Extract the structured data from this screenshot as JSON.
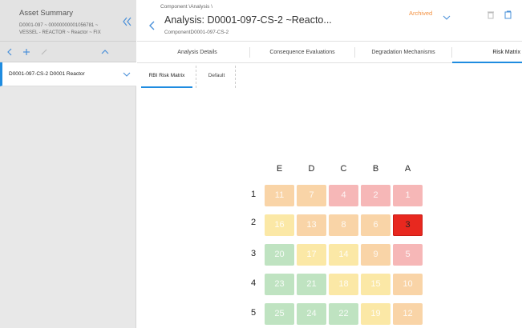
{
  "asset_summary": {
    "title": "Asset Summary",
    "line1": "D0001-097 ~ 00000000001056781 ~",
    "line2": "VESSEL - REACTOR ~ Reactor ~ FIX"
  },
  "left_item": {
    "label": "D0001-097-CS-2 D0001 Reactor"
  },
  "header": {
    "breadcrumb": "Component \\Analysis \\",
    "title": "Analysis: D0001-097-CS-2 ~Reacto...",
    "subtitle": "ComponentD0001-097-CS-2",
    "status": "Archived"
  },
  "tabs": [
    "Analysis Details",
    "Consequence Evaluations",
    "Degradation Mechanisms",
    "Risk Matrix"
  ],
  "subtabs": [
    "RBI Risk Matrix",
    "Default"
  ],
  "matrix": {
    "columns": [
      "E",
      "D",
      "C",
      "B",
      "A"
    ],
    "rows": [
      "1",
      "2",
      "3",
      "4",
      "5"
    ],
    "values": [
      [
        "11",
        "7",
        "4",
        "2",
        "1"
      ],
      [
        "16",
        "13",
        "8",
        "6",
        "3"
      ],
      [
        "20",
        "17",
        "14",
        "9",
        "5"
      ],
      [
        "23",
        "21",
        "18",
        "15",
        "10"
      ],
      [
        "25",
        "24",
        "22",
        "19",
        "12"
      ]
    ],
    "colors": {
      "orange": "#f9d4a7",
      "yellow": "#fbe8a6",
      "pink": "#f6b7b7",
      "green": "#bfe3c1",
      "red": "#e8281f"
    }
  }
}
